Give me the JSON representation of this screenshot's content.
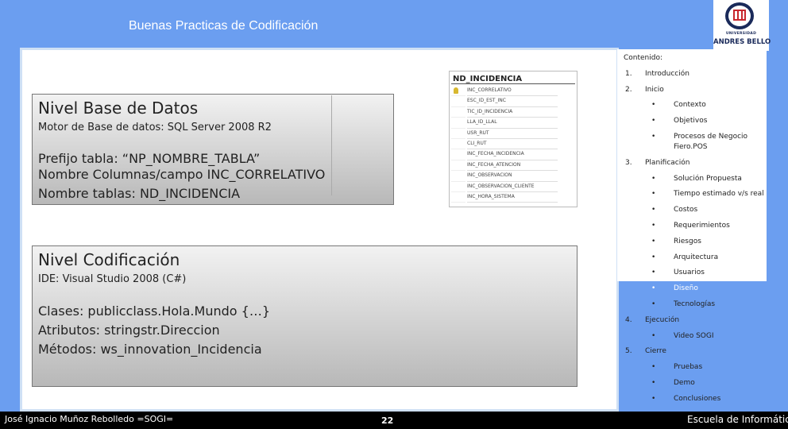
{
  "header": {
    "title": "Buenas Practicas de Codificación"
  },
  "logo": {
    "small_text": "UNIVERSIDAD",
    "name": "ANDRES BELLO",
    "colors": {
      "navy": "#1a2a5a",
      "red": "#c8282e"
    }
  },
  "box1": {
    "heading": "Nivel Base de Datos",
    "motor": "Motor de Base de datos: SQL Server 2008 R2",
    "lines": [
      "Prefijo tabla: “NP_NOMBRE_TABLA”",
      "Nombre Columnas/campo  INC_CORRELATIVO",
      "Nombre tablas: ND_INCIDENCIA"
    ]
  },
  "table": {
    "name": "ND_INCIDENCIA",
    "columns": [
      "INC_CORRELATIVO",
      "ESC_ID_EST_INC",
      "TIC_ID_INCIDENCIA",
      "LLA_ID_LLAL",
      "USR_RUT",
      "CLI_RUT",
      "INC_FECHA_INCIDENCIA",
      "INC_FECHA_ATENCION",
      "INC_OBSERVACION",
      "INC_OBSERVACION_CLIENTE",
      "INC_HORA_SISTEMA"
    ]
  },
  "box2": {
    "heading": "Nivel Codificación",
    "ide": "IDE: Visual Studio 2008 (C#)",
    "lines": [
      "Clases: publicclass.Hola.Mundo {…}",
      "Atributos: stringstr.Direccion",
      "Métodos: ws_innovation_Incidencia"
    ]
  },
  "toc": {
    "title": "Contenido:",
    "items": [
      {
        "num": "1.",
        "label": "Introducción",
        "sub": []
      },
      {
        "num": "2.",
        "label": "Inicio",
        "sub": [
          "Contexto",
          "Objetivos",
          "Procesos de Negocio",
          "Fiero.POS"
        ]
      },
      {
        "num": "3.",
        "label": "Planificación",
        "sub": [
          "Solución Propuesta",
          "Tiempo estimado v/s real",
          "Costos",
          "Requerimientos",
          "Riesgos",
          "Arquitectura",
          "Usuarios",
          "Diseño",
          "Tecnologías"
        ]
      },
      {
        "num": "4.",
        "label": "Ejecución",
        "sub": [
          "Video SOGI"
        ]
      },
      {
        "num": "5.",
        "label": "Cierre",
        "sub": [
          "Pruebas",
          "Demo",
          "Conclusiones"
        ]
      }
    ]
  },
  "footer": {
    "author": "José Ignacio Muñoz Rebolledo  =SOGI=",
    "page": "22",
    "school": "Escuela de Informática"
  }
}
